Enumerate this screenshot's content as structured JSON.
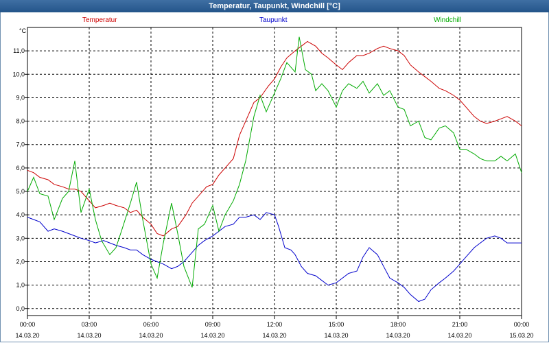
{
  "window": {
    "title": "Temperatur, Taupunkt, Windchill [°C]"
  },
  "chart_data": {
    "type": "line",
    "title": "Temperatur, Taupunkt, Windchill [°C]",
    "ylabel": "°C",
    "ylim": [
      -0.3,
      12.0
    ],
    "yticks": [
      "0,0",
      "1,0",
      "2,0",
      "3,0",
      "4,0",
      "5,0",
      "6,0",
      "7,0",
      "8,0",
      "9,0",
      "10,0",
      "11,0"
    ],
    "xlim_hours": [
      0,
      24
    ],
    "xticks": [
      {
        "time": "00:00",
        "date": "14.03.20"
      },
      {
        "time": "03:00",
        "date": "14.03.20"
      },
      {
        "time": "06:00",
        "date": "14.03.20"
      },
      {
        "time": "09:00",
        "date": "14.03.20"
      },
      {
        "time": "12:00",
        "date": "14.03.20"
      },
      {
        "time": "15:00",
        "date": "14.03.20"
      },
      {
        "time": "18:00",
        "date": "14.03.20"
      },
      {
        "time": "21:00",
        "date": "14.03.20"
      },
      {
        "time": "00:00",
        "date": "15.03.20"
      }
    ],
    "grid": true,
    "series": [
      {
        "name": "Temperatur",
        "color": "#cc0000",
        "points": [
          [
            0,
            5.9
          ],
          [
            0.3,
            5.8
          ],
          [
            0.6,
            5.6
          ],
          [
            1,
            5.5
          ],
          [
            1.3,
            5.3
          ],
          [
            1.7,
            5.2
          ],
          [
            2,
            5.1
          ],
          [
            2.3,
            5.1
          ],
          [
            2.6,
            5.0
          ],
          [
            3,
            4.6
          ],
          [
            3.3,
            4.3
          ],
          [
            3.7,
            4.4
          ],
          [
            4,
            4.5
          ],
          [
            4.3,
            4.4
          ],
          [
            4.7,
            4.3
          ],
          [
            5,
            4.1
          ],
          [
            5.3,
            4.2
          ],
          [
            5.6,
            3.9
          ],
          [
            6,
            3.6
          ],
          [
            6.3,
            3.2
          ],
          [
            6.6,
            3.1
          ],
          [
            7,
            3.4
          ],
          [
            7.3,
            3.5
          ],
          [
            7.7,
            4.0
          ],
          [
            8,
            4.5
          ],
          [
            8.3,
            4.8
          ],
          [
            8.7,
            5.2
          ],
          [
            9,
            5.3
          ],
          [
            9.3,
            5.7
          ],
          [
            9.6,
            6.0
          ],
          [
            10,
            6.4
          ],
          [
            10.3,
            7.4
          ],
          [
            10.6,
            8.0
          ],
          [
            11,
            8.8
          ],
          [
            11.3,
            9.0
          ],
          [
            11.7,
            9.5
          ],
          [
            12,
            9.8
          ],
          [
            12.3,
            10.3
          ],
          [
            12.6,
            10.7
          ],
          [
            13,
            11.0
          ],
          [
            13.3,
            11.2
          ],
          [
            13.6,
            11.4
          ],
          [
            14,
            11.2
          ],
          [
            14.3,
            10.9
          ],
          [
            14.6,
            10.7
          ],
          [
            15,
            10.4
          ],
          [
            15.3,
            10.2
          ],
          [
            15.6,
            10.5
          ],
          [
            16,
            10.8
          ],
          [
            16.3,
            10.8
          ],
          [
            16.6,
            10.9
          ],
          [
            17,
            11.1
          ],
          [
            17.3,
            11.2
          ],
          [
            17.6,
            11.1
          ],
          [
            18,
            11.0
          ],
          [
            18.3,
            10.8
          ],
          [
            18.6,
            10.4
          ],
          [
            19,
            10.1
          ],
          [
            19.3,
            9.9
          ],
          [
            19.6,
            9.7
          ],
          [
            20,
            9.4
          ],
          [
            20.3,
            9.3
          ],
          [
            20.7,
            9.1
          ],
          [
            21,
            8.9
          ],
          [
            21.3,
            8.6
          ],
          [
            21.7,
            8.2
          ],
          [
            22,
            8.0
          ],
          [
            22.3,
            7.9
          ],
          [
            22.7,
            8.0
          ],
          [
            23,
            8.1
          ],
          [
            23.3,
            8.2
          ],
          [
            23.7,
            8.0
          ],
          [
            24,
            7.8
          ]
        ]
      },
      {
        "name": "Taupunkt",
        "color": "#0000cc",
        "points": [
          [
            0,
            3.9
          ],
          [
            0.3,
            3.8
          ],
          [
            0.6,
            3.7
          ],
          [
            1,
            3.3
          ],
          [
            1.3,
            3.4
          ],
          [
            1.7,
            3.3
          ],
          [
            2,
            3.2
          ],
          [
            2.3,
            3.1
          ],
          [
            2.6,
            3.0
          ],
          [
            3,
            2.9
          ],
          [
            3.3,
            2.8
          ],
          [
            3.7,
            2.9
          ],
          [
            4,
            2.8
          ],
          [
            4.3,
            2.7
          ],
          [
            4.7,
            2.6
          ],
          [
            5,
            2.5
          ],
          [
            5.3,
            2.5
          ],
          [
            5.6,
            2.3
          ],
          [
            6,
            2.1
          ],
          [
            6.3,
            2.0
          ],
          [
            6.6,
            1.9
          ],
          [
            7,
            1.7
          ],
          [
            7.3,
            1.8
          ],
          [
            7.6,
            2.0
          ],
          [
            8,
            2.4
          ],
          [
            8.3,
            2.7
          ],
          [
            8.6,
            2.9
          ],
          [
            9,
            3.1
          ],
          [
            9.3,
            3.3
          ],
          [
            9.6,
            3.5
          ],
          [
            10,
            3.6
          ],
          [
            10.3,
            3.9
          ],
          [
            10.6,
            3.9
          ],
          [
            11,
            4.0
          ],
          [
            11.3,
            3.8
          ],
          [
            11.6,
            4.1
          ],
          [
            12,
            4.0
          ],
          [
            12.2,
            3.5
          ],
          [
            12.5,
            2.6
          ],
          [
            12.8,
            2.5
          ],
          [
            13,
            2.3
          ],
          [
            13.3,
            1.8
          ],
          [
            13.6,
            1.5
          ],
          [
            14,
            1.4
          ],
          [
            14.3,
            1.2
          ],
          [
            14.6,
            1.0
          ],
          [
            15,
            1.1
          ],
          [
            15.3,
            1.3
          ],
          [
            15.6,
            1.5
          ],
          [
            16,
            1.6
          ],
          [
            16.3,
            2.2
          ],
          [
            16.6,
            2.6
          ],
          [
            17,
            2.3
          ],
          [
            17.3,
            1.8
          ],
          [
            17.6,
            1.3
          ],
          [
            18,
            1.1
          ],
          [
            18.3,
            0.9
          ],
          [
            18.6,
            0.6
          ],
          [
            19,
            0.3
          ],
          [
            19.3,
            0.4
          ],
          [
            19.6,
            0.8
          ],
          [
            20,
            1.1
          ],
          [
            20.3,
            1.3
          ],
          [
            20.7,
            1.6
          ],
          [
            21,
            1.9
          ],
          [
            21.3,
            2.2
          ],
          [
            21.7,
            2.6
          ],
          [
            22,
            2.8
          ],
          [
            22.3,
            3.0
          ],
          [
            22.7,
            3.1
          ],
          [
            23,
            3.0
          ],
          [
            23.3,
            2.8
          ],
          [
            23.7,
            2.8
          ],
          [
            24,
            2.8
          ]
        ]
      },
      {
        "name": "Windchill",
        "color": "#00aa00",
        "points": [
          [
            0,
            5.0
          ],
          [
            0.3,
            5.6
          ],
          [
            0.6,
            4.9
          ],
          [
            1,
            4.8
          ],
          [
            1.3,
            3.8
          ],
          [
            1.7,
            4.7
          ],
          [
            2,
            5.0
          ],
          [
            2.3,
            6.3
          ],
          [
            2.6,
            4.1
          ],
          [
            3,
            5.1
          ],
          [
            3.3,
            3.8
          ],
          [
            3.6,
            2.9
          ],
          [
            4,
            2.3
          ],
          [
            4.3,
            2.6
          ],
          [
            4.6,
            3.4
          ],
          [
            5,
            4.5
          ],
          [
            5.3,
            5.4
          ],
          [
            5.6,
            3.8
          ],
          [
            6,
            1.9
          ],
          [
            6.3,
            1.3
          ],
          [
            6.6,
            2.8
          ],
          [
            7,
            4.5
          ],
          [
            7.3,
            3.2
          ],
          [
            7.6,
            1.8
          ],
          [
            8,
            0.9
          ],
          [
            8.3,
            3.4
          ],
          [
            8.6,
            3.6
          ],
          [
            9,
            4.4
          ],
          [
            9.3,
            3.3
          ],
          [
            9.6,
            4.0
          ],
          [
            10,
            4.6
          ],
          [
            10.3,
            5.3
          ],
          [
            10.6,
            6.3
          ],
          [
            11,
            8.2
          ],
          [
            11.3,
            9.1
          ],
          [
            11.6,
            8.4
          ],
          [
            12,
            9.2
          ],
          [
            12.3,
            9.8
          ],
          [
            12.6,
            10.5
          ],
          [
            13,
            10.1
          ],
          [
            13.2,
            11.6
          ],
          [
            13.5,
            10.2
          ],
          [
            13.8,
            10.0
          ],
          [
            14,
            9.3
          ],
          [
            14.3,
            9.6
          ],
          [
            14.6,
            9.3
          ],
          [
            15,
            8.6
          ],
          [
            15.3,
            9.3
          ],
          [
            15.6,
            9.6
          ],
          [
            16,
            9.4
          ],
          [
            16.3,
            9.7
          ],
          [
            16.6,
            9.2
          ],
          [
            17,
            9.6
          ],
          [
            17.3,
            9.1
          ],
          [
            17.6,
            9.3
          ],
          [
            18,
            8.6
          ],
          [
            18.3,
            8.5
          ],
          [
            18.6,
            7.8
          ],
          [
            19,
            8.0
          ],
          [
            19.3,
            7.3
          ],
          [
            19.6,
            7.2
          ],
          [
            20,
            7.7
          ],
          [
            20.3,
            7.8
          ],
          [
            20.7,
            7.5
          ],
          [
            21,
            6.8
          ],
          [
            21.3,
            6.8
          ],
          [
            21.7,
            6.6
          ],
          [
            22,
            6.4
          ],
          [
            22.3,
            6.3
          ],
          [
            22.7,
            6.3
          ],
          [
            23,
            6.5
          ],
          [
            23.3,
            6.3
          ],
          [
            23.7,
            6.6
          ],
          [
            24,
            5.8
          ]
        ]
      }
    ]
  }
}
